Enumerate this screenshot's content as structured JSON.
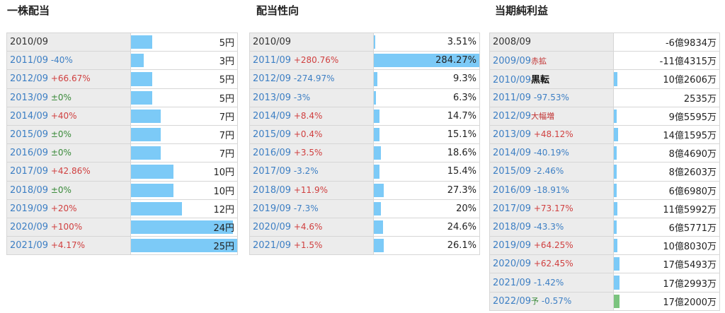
{
  "dividend": {
    "title": "一株配当",
    "rows": [
      {
        "year": "2010/09",
        "change": "",
        "dir": "",
        "value": "5円",
        "pct": 0.2
      },
      {
        "year": "2011/09",
        "change": "-40%",
        "dir": "down",
        "value": "3円",
        "pct": 0.12
      },
      {
        "year": "2012/09",
        "change": "+66.67%",
        "dir": "up",
        "value": "5円",
        "pct": 0.2
      },
      {
        "year": "2013/09",
        "change": "±0%",
        "dir": "flat",
        "value": "5円",
        "pct": 0.2
      },
      {
        "year": "2014/09",
        "change": "+40%",
        "dir": "up",
        "value": "7円",
        "pct": 0.28
      },
      {
        "year": "2015/09",
        "change": "±0%",
        "dir": "flat",
        "value": "7円",
        "pct": 0.28
      },
      {
        "year": "2016/09",
        "change": "±0%",
        "dir": "flat",
        "value": "7円",
        "pct": 0.28
      },
      {
        "year": "2017/09",
        "change": "+42.86%",
        "dir": "up",
        "value": "10円",
        "pct": 0.4
      },
      {
        "year": "2018/09",
        "change": "±0%",
        "dir": "flat",
        "value": "10円",
        "pct": 0.4
      },
      {
        "year": "2019/09",
        "change": "+20%",
        "dir": "up",
        "value": "12円",
        "pct": 0.48
      },
      {
        "year": "2020/09",
        "change": "+100%",
        "dir": "up",
        "value": "24円",
        "pct": 0.96
      },
      {
        "year": "2021/09",
        "change": "+4.17%",
        "dir": "up",
        "value": "25円",
        "pct": 1.0
      }
    ]
  },
  "payout": {
    "title": "配当性向",
    "rows": [
      {
        "year": "2010/09",
        "change": "",
        "dir": "",
        "value": "3.51%",
        "pct": 0.0123
      },
      {
        "year": "2011/09",
        "change": "+280.76%",
        "dir": "up",
        "value": "284.27%",
        "pct": 1.0
      },
      {
        "year": "2012/09",
        "change": "-274.97%",
        "dir": "down",
        "value": "9.3%",
        "pct": 0.0327
      },
      {
        "year": "2013/09",
        "change": "-3%",
        "dir": "down",
        "value": "6.3%",
        "pct": 0.0222
      },
      {
        "year": "2014/09",
        "change": "+8.4%",
        "dir": "up",
        "value": "14.7%",
        "pct": 0.0517
      },
      {
        "year": "2015/09",
        "change": "+0.4%",
        "dir": "up",
        "value": "15.1%",
        "pct": 0.0531
      },
      {
        "year": "2016/09",
        "change": "+3.5%",
        "dir": "up",
        "value": "18.6%",
        "pct": 0.0654
      },
      {
        "year": "2017/09",
        "change": "-3.2%",
        "dir": "down",
        "value": "15.4%",
        "pct": 0.0542
      },
      {
        "year": "2018/09",
        "change": "+11.9%",
        "dir": "up",
        "value": "27.3%",
        "pct": 0.096
      },
      {
        "year": "2019/09",
        "change": "-7.3%",
        "dir": "down",
        "value": "20%",
        "pct": 0.0704
      },
      {
        "year": "2020/09",
        "change": "+4.6%",
        "dir": "up",
        "value": "24.6%",
        "pct": 0.0865
      },
      {
        "year": "2021/09",
        "change": "+1.5%",
        "dir": "up",
        "value": "26.1%",
        "pct": 0.0918
      }
    ]
  },
  "profit": {
    "title": "当期純利益",
    "rows": [
      {
        "year": "2008/09",
        "note": "",
        "change": "",
        "dir": "",
        "value": "-6億9834万",
        "pct": 0,
        "green": false
      },
      {
        "year": "2009/09",
        "note": "赤拡",
        "change": "",
        "dir": "big",
        "value": "-11億4315万",
        "pct": 0,
        "green": false
      },
      {
        "year": "2010/09",
        "note": "黒転",
        "change": "",
        "dir": "black",
        "value": "10億2606万",
        "pct": 0.03,
        "green": false
      },
      {
        "year": "2011/09",
        "note": "",
        "change": "-97.53%",
        "dir": "down",
        "value": "2535万",
        "pct": 0.001,
        "green": false
      },
      {
        "year": "2012/09",
        "note": "大幅増",
        "change": "",
        "dir": "big",
        "value": "9億5595万",
        "pct": 0.028,
        "green": false
      },
      {
        "year": "2013/09",
        "note": "",
        "change": "+48.12%",
        "dir": "up",
        "value": "14億1595万",
        "pct": 0.041,
        "green": false
      },
      {
        "year": "2014/09",
        "note": "",
        "change": "-40.19%",
        "dir": "down",
        "value": "8億4690万",
        "pct": 0.025,
        "green": false
      },
      {
        "year": "2015/09",
        "note": "",
        "change": "-2.46%",
        "dir": "down",
        "value": "8億2603万",
        "pct": 0.024,
        "green": false
      },
      {
        "year": "2016/09",
        "note": "",
        "change": "-18.91%",
        "dir": "down",
        "value": "6億6980万",
        "pct": 0.02,
        "green": false
      },
      {
        "year": "2017/09",
        "note": "",
        "change": "+73.17%",
        "dir": "up",
        "value": "11億5992万",
        "pct": 0.034,
        "green": false
      },
      {
        "year": "2018/09",
        "note": "",
        "change": "-43.3%",
        "dir": "down",
        "value": "6億5771万",
        "pct": 0.019,
        "green": false
      },
      {
        "year": "2019/09",
        "note": "",
        "change": "+64.25%",
        "dir": "up",
        "value": "10億8030万",
        "pct": 0.032,
        "green": false
      },
      {
        "year": "2020/09",
        "note": "",
        "change": "+62.45%",
        "dir": "up",
        "value": "17億5493万",
        "pct": 0.051,
        "green": false
      },
      {
        "year": "2021/09",
        "note": "",
        "change": "-1.42%",
        "dir": "down",
        "value": "17億2993万",
        "pct": 0.05,
        "green": false
      },
      {
        "year": "2022/09",
        "note": "予",
        "change": "-0.57%",
        "dir": "down",
        "value": "17億2000万",
        "pct": 0.05,
        "green": true
      }
    ]
  }
}
